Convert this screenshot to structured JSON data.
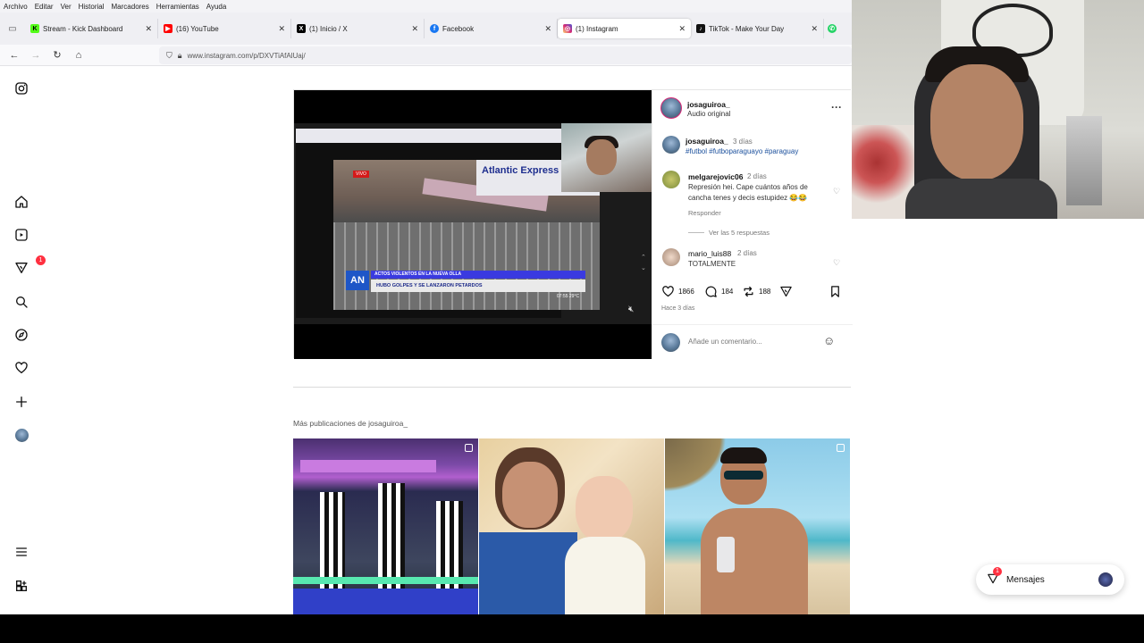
{
  "menubar": [
    "Archivo",
    "Editar",
    "Ver",
    "Historial",
    "Marcadores",
    "Herramientas",
    "Ayuda"
  ],
  "tabs": [
    {
      "title": "Stream - Kick Dashboard",
      "icon": "kick-icon",
      "color": "#53fc18",
      "glyph": "K"
    },
    {
      "title": "(16) YouTube",
      "icon": "youtube-icon",
      "color": "#ff0000",
      "glyph": "▶"
    },
    {
      "title": "(1) Inicio / X",
      "icon": "x-icon",
      "color": "#000000",
      "glyph": "X"
    },
    {
      "title": "Facebook",
      "icon": "facebook-icon",
      "color": "#1877f2",
      "glyph": "f"
    },
    {
      "title": "(1) Instagram",
      "icon": "instagram-icon",
      "color": "#d62976",
      "glyph": "◎"
    },
    {
      "title": "TikTok - Make Your Day",
      "icon": "tiktok-icon",
      "color": "#111111",
      "glyph": "♪"
    }
  ],
  "url": "www.instagram.com/p/DXVTiAfAlUaj/",
  "rail_badge": "1",
  "post": {
    "author": "josaguiroa_",
    "audio": "Audio original",
    "caption_time": "3 días",
    "caption_tags": "#futbol #futboparaguayo #paraguay",
    "video": {
      "live_label": "VIVO",
      "brand": "Atlantic Express",
      "channel_logo": "AN",
      "headline_top": "ACTOS VIOLENTOS EN LA NUEVA OLLA",
      "headline_bottom": "HUBO GOLPES Y SE LANZARON PETARDOS",
      "clock": "07:55 29°C"
    },
    "comments": [
      {
        "user": "melgarejovic06",
        "time": "2 días",
        "text": "Represión hei. Cape cuántos años de cancha tenes y decis estupidez 😂😂",
        "reply": "Responder",
        "view_replies": "Ver las 5 respuestas"
      },
      {
        "user": "mario_luis88",
        "time": "2 días",
        "text": "TOTALMENTE"
      }
    ],
    "likes": "1866",
    "comments_count": "184",
    "reposts": "188",
    "posted": "Hace 3 días",
    "add_comment_placeholder": "Añade un comentario..."
  },
  "more_posts_title": "Más publicaciones de josaguiroa_",
  "messages_label": "Mensajes",
  "messages_badge": "1"
}
